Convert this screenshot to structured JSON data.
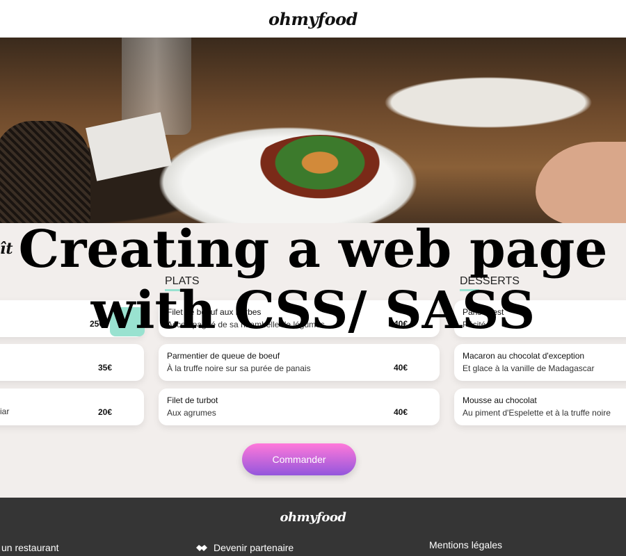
{
  "header": {
    "brand": "ohmyfood"
  },
  "overlay": {
    "title_line1": "Creating a web page",
    "title_line2": "with CSS/ SASS",
    "left_glyph": "ît"
  },
  "columns": {
    "plats": "PLATS",
    "desserts": "DESSERTS"
  },
  "entrees": [
    {
      "price": "25€"
    },
    {
      "price": "35€"
    },
    {
      "desc_fragment": "iar",
      "price": "20€"
    }
  ],
  "plats": [
    {
      "name": "Filet de boeuf aux herbes",
      "desc": "Accompagné de sa ribambelle de légumes",
      "price": "40€"
    },
    {
      "name": "Parmentier de queue de boeuf",
      "desc": "À la truffe noire sur sa purée de panais",
      "price": "40€"
    },
    {
      "name": "Filet de turbot",
      "desc": "Aux agrumes",
      "price": "40€"
    }
  ],
  "desserts": [
    {
      "name": "Paris-Brest",
      "desc": "Pécité"
    },
    {
      "name": "Macaron au chocolat d'exception",
      "desc": "Et glace à la vanille de Madagascar"
    },
    {
      "name": "Mousse au chocolat",
      "desc": "Au piment d'Espelette et à la truffe noire"
    }
  ],
  "order_button": "Commander",
  "footer": {
    "brand": "ohmyfood",
    "link_restaurant": "un restaurant",
    "link_partner": "Devenir partenaire",
    "link_legal": "Mentions légales"
  }
}
